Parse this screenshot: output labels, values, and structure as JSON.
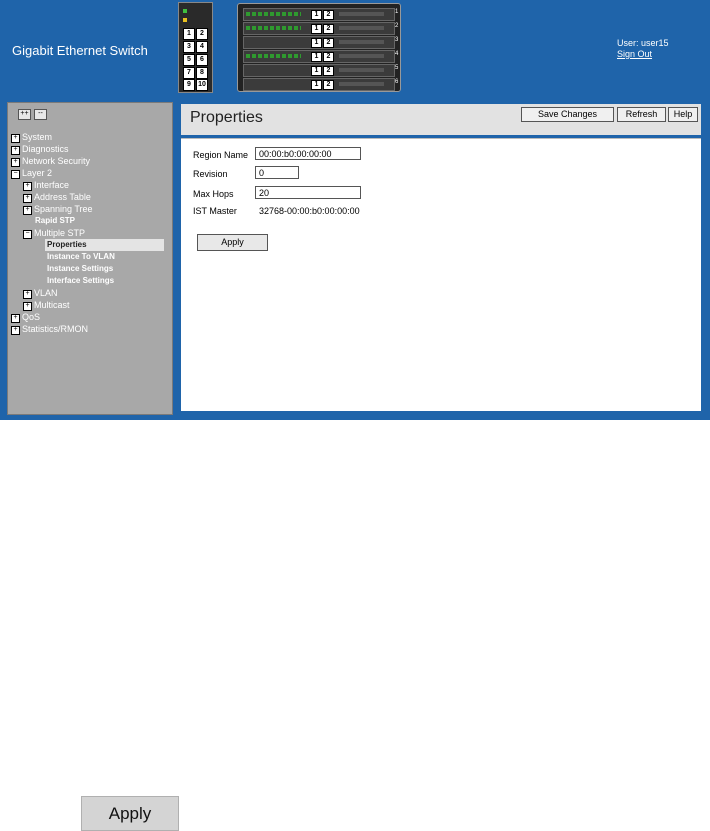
{
  "header": {
    "brand": "Gigabit Ethernet Switch",
    "user": "User: user15",
    "signout": "Sign Out",
    "small_panel_ports": [
      "1",
      "2",
      "3",
      "4",
      "5",
      "6",
      "7",
      "8",
      "9",
      "10"
    ],
    "chassis_slot_ports": [
      [
        "1",
        "2"
      ],
      [
        "1",
        "2"
      ],
      [
        "1",
        "2"
      ],
      [
        "1",
        "2"
      ],
      [
        "1",
        "2"
      ],
      [
        "1",
        "2"
      ]
    ],
    "chassis_slot_numbers": [
      "1",
      "2",
      "3",
      "4",
      "5",
      "6"
    ]
  },
  "nav": {
    "expand_all": "++",
    "collapse_all": "--",
    "tree": [
      {
        "label": "System",
        "icon": "plus"
      },
      {
        "label": "Diagnostics",
        "icon": "plus"
      },
      {
        "label": "Network Security",
        "icon": "plus"
      },
      {
        "label": "Layer 2",
        "icon": "minus"
      },
      {
        "label": "Interface",
        "icon": "plus"
      },
      {
        "label": "Address Table",
        "icon": "plus"
      },
      {
        "label": "Spanning Tree",
        "icon": "plus"
      },
      {
        "label": "Rapid STP",
        "icon": ""
      },
      {
        "label": "Multiple STP",
        "icon": "minus"
      },
      {
        "label": "Properties",
        "icon": ""
      },
      {
        "label": "Instance To VLAN",
        "icon": ""
      },
      {
        "label": "Instance Settings",
        "icon": ""
      },
      {
        "label": "Interface Settings",
        "icon": ""
      },
      {
        "label": "VLAN",
        "icon": "plus"
      },
      {
        "label": "Multicast",
        "icon": "plus"
      },
      {
        "label": "QoS",
        "icon": "plus"
      },
      {
        "label": "Statistics/RMON",
        "icon": "plus"
      }
    ]
  },
  "main": {
    "title": "Properties",
    "buttons": {
      "save": "Save Changes",
      "refresh": "Refresh",
      "help": "Help"
    },
    "form": {
      "region_name_label": "Region Name",
      "region_name_value": "00:00:b0:00:00:00",
      "revision_label": "Revision",
      "revision_value": "0",
      "max_hops_label": "Max Hops",
      "max_hops_value": "20",
      "ist_master_label": "IST Master",
      "ist_master_value": "32768-00:00:b0:00:00:00",
      "apply_label": "Apply"
    }
  },
  "apply_large_label": "Apply",
  "colors": {
    "header_bg": "#1f64aa",
    "nav_bg": "#a8a8a8",
    "title_bar_bg": "#e2e2e2"
  }
}
